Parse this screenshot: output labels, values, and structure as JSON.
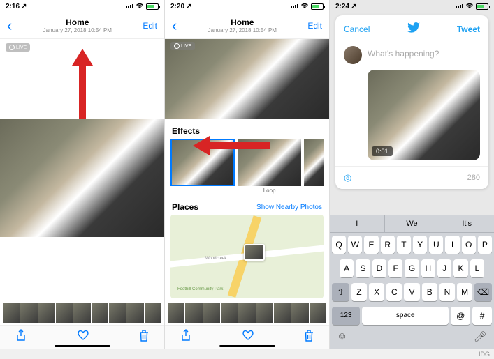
{
  "screen1": {
    "status_time": "2:16",
    "nav": {
      "title": "Home",
      "subtitle": "January 27, 2018  10:54 PM",
      "edit": "Edit"
    },
    "live_badge": "LIVE"
  },
  "screen2": {
    "status_time": "2:20",
    "nav": {
      "title": "Home",
      "subtitle": "January 27, 2018  10:54 PM",
      "edit": "Edit"
    },
    "live_badge": "LIVE",
    "effects": {
      "label": "Effects",
      "items": [
        "",
        "Loop",
        ""
      ]
    },
    "places": {
      "label": "Places",
      "link": "Show Nearby Photos",
      "park": "Foothill Community Park",
      "road": "Woodcreek"
    }
  },
  "screen3": {
    "status_time": "2:24",
    "compose": {
      "cancel": "Cancel",
      "tweet": "Tweet",
      "placeholder": "What's happening?",
      "duration": "0:01",
      "char_count": "280"
    },
    "keyboard": {
      "suggestions": [
        "I",
        "We",
        "It's"
      ],
      "row1": [
        "Q",
        "W",
        "E",
        "R",
        "T",
        "Y",
        "U",
        "I",
        "O",
        "P"
      ],
      "row2": [
        "A",
        "S",
        "D",
        "F",
        "G",
        "H",
        "J",
        "K",
        "L"
      ],
      "row3": [
        "Z",
        "X",
        "C",
        "V",
        "B",
        "N",
        "M"
      ],
      "numkey": "123",
      "space": "space",
      "at": "@",
      "hash": "#"
    }
  },
  "credit": "IDG"
}
